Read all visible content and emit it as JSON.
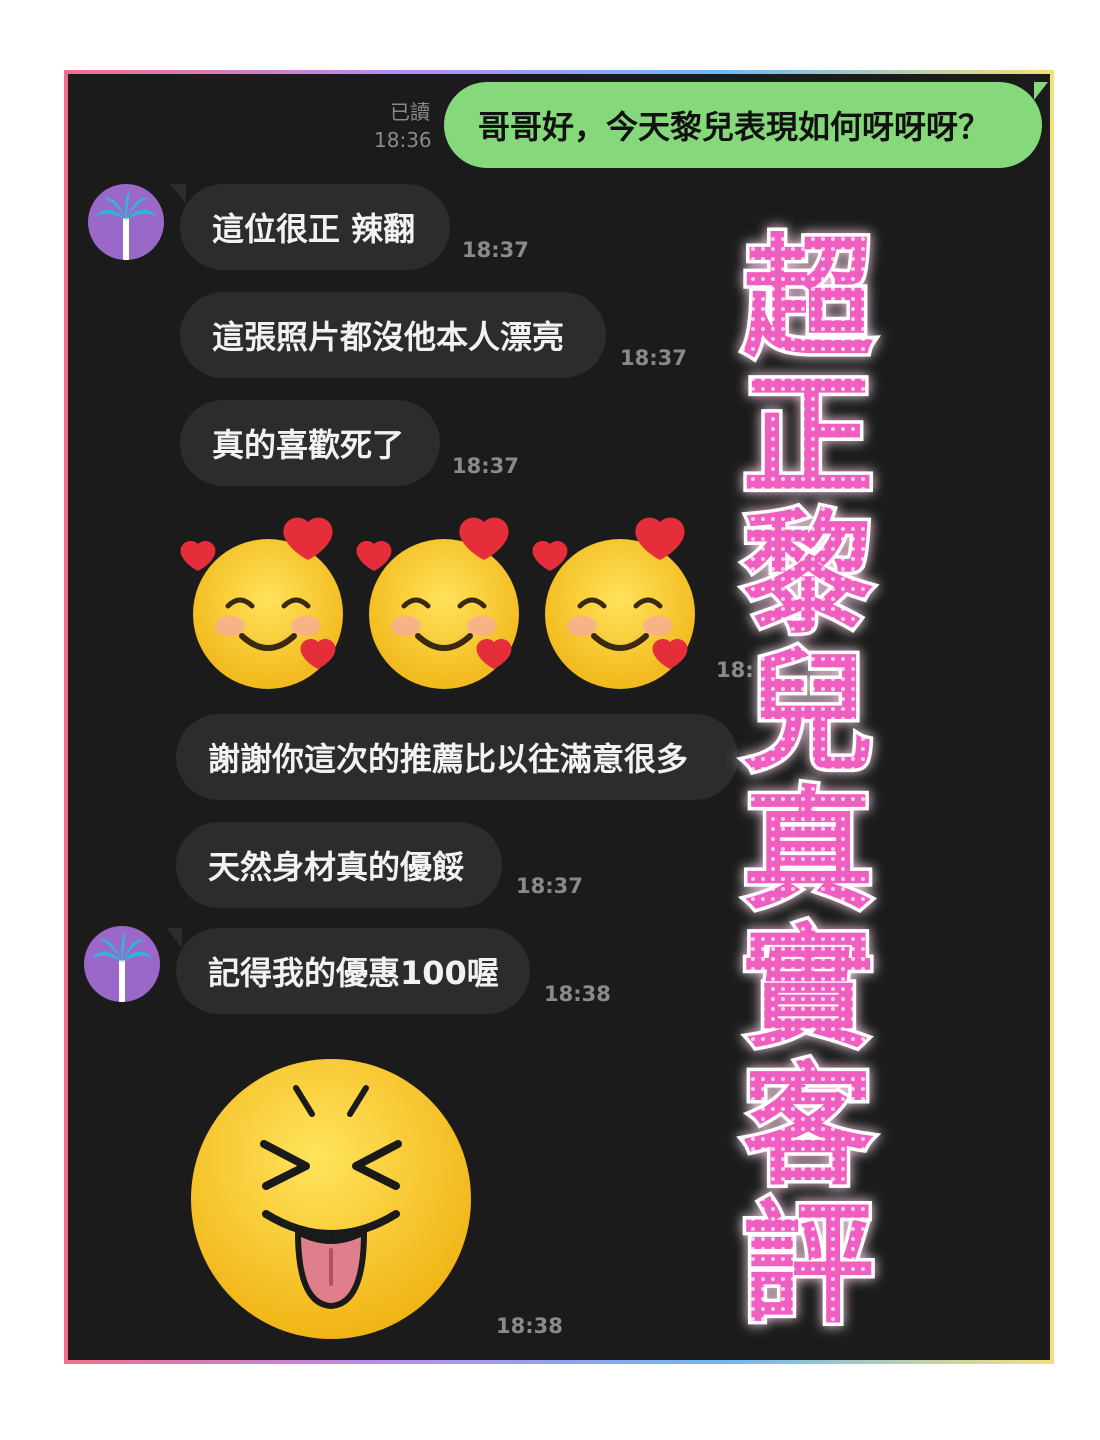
{
  "messages": {
    "outgoing": {
      "text": "哥哥好，今天黎兒表現如何呀呀呀？",
      "read_label": "已讀",
      "time": "18:36"
    },
    "incoming": [
      {
        "text": "這位很正 辣翻",
        "time": "18:37"
      },
      {
        "text": "這張照片都沒他本人漂亮",
        "time": "18:37"
      },
      {
        "text": "真的喜歡死了",
        "time": "18:37"
      },
      {
        "time": "18:"
      },
      {
        "text": "謝謝你這次的推薦比以往滿意很多"
      },
      {
        "text": "天然身材真的優餒",
        "time": "18:37"
      },
      {
        "text": "記得我的優惠100喔",
        "time": "18:38"
      },
      {
        "time": "18:38"
      }
    ]
  },
  "stickers": {
    "hearts_emoji": "smiling-face-with-hearts-icon",
    "tongue_emoji": "squinting-face-with-tongue-icon"
  },
  "avatar_icon": "palm-tree-icon",
  "banner": {
    "text": "超正黎兒真實客評",
    "color": "#f05fc0"
  }
}
